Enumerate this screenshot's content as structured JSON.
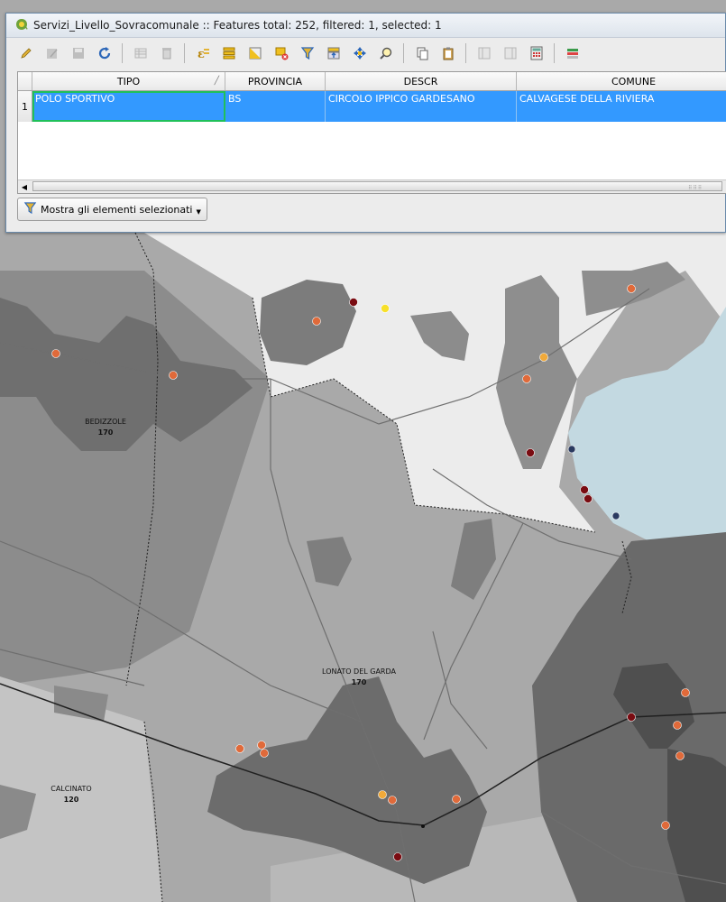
{
  "window": {
    "title": "Servizi_Livello_Sovracomunale :: Features total: 252, filtered: 1, selected: 1"
  },
  "toolbar": {
    "buttons": [
      {
        "icon": "pencil-icon",
        "enabled": true
      },
      {
        "icon": "save-edits-icon",
        "enabled": false
      },
      {
        "icon": "disk-icon",
        "enabled": false
      },
      {
        "icon": "reload-icon",
        "enabled": true
      },
      {
        "icon": "add-feature-icon",
        "enabled": false
      },
      {
        "icon": "trash-icon",
        "enabled": false
      },
      {
        "icon": "select-expression-icon",
        "enabled": true
      },
      {
        "icon": "select-all-icon",
        "enabled": true
      },
      {
        "icon": "invert-selection-icon",
        "enabled": true
      },
      {
        "icon": "deselect-icon",
        "enabled": true
      },
      {
        "icon": "filter-funnel-icon",
        "enabled": true
      },
      {
        "icon": "move-selection-top-icon",
        "enabled": true
      },
      {
        "icon": "pan-to-selection-icon",
        "enabled": true
      },
      {
        "icon": "zoom-to-selection-icon",
        "enabled": true
      },
      {
        "icon": "copy-icon",
        "enabled": true
      },
      {
        "icon": "paste-icon",
        "enabled": true
      },
      {
        "icon": "delete-field-icon",
        "enabled": false
      },
      {
        "icon": "new-field-icon",
        "enabled": false
      },
      {
        "icon": "field-calculator-icon",
        "enabled": true
      },
      {
        "icon": "conditional-format-icon",
        "enabled": true
      }
    ]
  },
  "table": {
    "columns": [
      "TIPO",
      "PROVINCIA",
      "DESCR",
      "COMUNE"
    ],
    "sorted_column": "TIPO",
    "rows": [
      {
        "num": "1",
        "cells": [
          "POLO SPORTIVO",
          "BS",
          "CIRCOLO IPPICO GARDESANO",
          "CALVAGESE DELLA RIVIERA"
        ]
      }
    ],
    "selection_color": "#3399ff"
  },
  "filter_button": {
    "label": "Mostra gli elementi selezionati",
    "icon": "filter-funnel-icon"
  },
  "map": {
    "colors": {
      "lake": "#c3d9e1",
      "light_area": "#ececec",
      "mid_area": "#a9a9a9",
      "urban": "#737373",
      "dark_urban": "#4f4f4f",
      "road": "#6f6f6f",
      "railway": "#202020"
    },
    "places": [
      {
        "name": "BEDIZZOLE",
        "code": "170"
      },
      {
        "name": "LONATO DEL GARDA",
        "code": "170"
      },
      {
        "name": "CALCINATO",
        "code": "120"
      }
    ],
    "point_colors": {
      "orange": "#e06a3a",
      "darkred": "#7a0c12",
      "yellow": "#f7e02a",
      "gold": "#f0a93a",
      "navy": "#2a3a60"
    }
  }
}
